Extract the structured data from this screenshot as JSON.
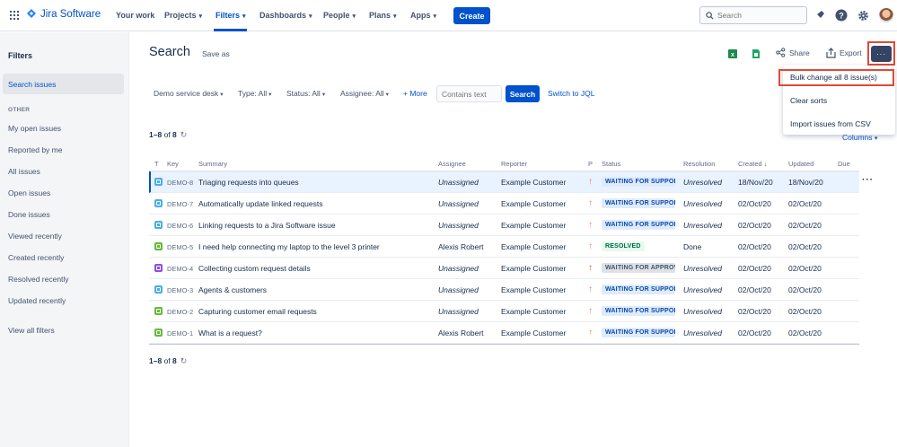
{
  "app": {
    "name": "Jira Software"
  },
  "nav": {
    "items": [
      {
        "label": "Your work",
        "chevron": false
      },
      {
        "label": "Projects",
        "chevron": true
      },
      {
        "label": "Filters",
        "chevron": true,
        "active": true
      },
      {
        "label": "Dashboards",
        "chevron": true
      },
      {
        "label": "People",
        "chevron": true
      },
      {
        "label": "Plans",
        "chevron": true
      },
      {
        "label": "Apps",
        "chevron": true
      }
    ],
    "create_label": "Create",
    "search_placeholder": "Search"
  },
  "sidebar": {
    "title": "Filters",
    "active_item": "Search issues",
    "section_label": "OTHER",
    "items": [
      "My open issues",
      "Reported by me",
      "All issues",
      "Open issues",
      "Done issues",
      "Viewed recently",
      "Created recently",
      "Resolved recently",
      "Updated recently"
    ],
    "footer_item": "View all filters"
  },
  "header": {
    "title": "Search",
    "save_as": "Save as",
    "share": "Share",
    "export": "Export",
    "more": "···"
  },
  "dropdown": {
    "items": [
      "Bulk change all 8 issue(s)",
      "Clear sorts",
      "Import issues from CSV"
    ]
  },
  "filters": {
    "project": "Demo service desk",
    "type": "Type: All",
    "status": "Status: All",
    "assignee": "Assignee: All",
    "more": "+ More",
    "contains_placeholder": "Contains text",
    "search_btn": "Search",
    "switch_jql": "Switch to JQL"
  },
  "results": {
    "range": "1–8",
    "of_text": "of",
    "total": "8",
    "columns_label": "Columns"
  },
  "table": {
    "headers": {
      "t": "T",
      "key": "Key",
      "summary": "Summary",
      "assignee": "Assignee",
      "reporter": "Reporter",
      "p": "P",
      "status": "Status",
      "resolution": "Resolution",
      "created": "Created ↓",
      "updated": "Updated",
      "due": "Due"
    },
    "rows": [
      {
        "key": "DEMO-8",
        "summary": "Triaging requests into queues",
        "assignee": "Unassigned",
        "reporter": "Example Customer",
        "status": "WAITING FOR SUPPORT",
        "resolution": "Unresolved",
        "created": "18/Nov/20",
        "updated": "18/Nov/20",
        "type_color": "#4bade8",
        "prio_color": "#ff7452",
        "status_kind": "blue",
        "unassigned": true
      },
      {
        "key": "DEMO-7",
        "summary": "Automatically update linked requests",
        "assignee": "Unassigned",
        "reporter": "Example Customer",
        "status": "WAITING FOR SUPPORT",
        "resolution": "Unresolved",
        "created": "02/Oct/20",
        "updated": "02/Oct/20",
        "type_color": "#4bade8",
        "prio_color": "#ff7452",
        "status_kind": "blue",
        "unassigned": true
      },
      {
        "key": "DEMO-6",
        "summary": "Linking requests to a Jira Software issue",
        "assignee": "Unassigned",
        "reporter": "Example Customer",
        "status": "WAITING FOR SUPPORT",
        "resolution": "Unresolved",
        "created": "02/Oct/20",
        "updated": "02/Oct/20",
        "type_color": "#4bade8",
        "prio_color": "#ff7452",
        "status_kind": "blue",
        "unassigned": true
      },
      {
        "key": "DEMO-5",
        "summary": "I need help connecting my laptop to the level 3 printer",
        "assignee": "Alexis Robert",
        "reporter": "Example Customer",
        "status": "RESOLVED",
        "resolution": "Done",
        "created": "02/Oct/20",
        "updated": "02/Oct/20",
        "type_color": "#63ba3c",
        "prio_color": "#ff7452",
        "status_kind": "green",
        "unassigned": false
      },
      {
        "key": "DEMO-4",
        "summary": "Collecting custom request details",
        "assignee": "Unassigned",
        "reporter": "Example Customer",
        "status": "WAITING FOR APPROVAL",
        "resolution": "Unresolved",
        "created": "02/Oct/20",
        "updated": "02/Oct/20",
        "type_color": "#904ee2",
        "prio_color": "#e5493a",
        "status_kind": "gray",
        "unassigned": true
      },
      {
        "key": "DEMO-3",
        "summary": "Agents & customers",
        "assignee": "Unassigned",
        "reporter": "Example Customer",
        "status": "WAITING FOR SUPPORT",
        "resolution": "Unresolved",
        "created": "02/Oct/20",
        "updated": "02/Oct/20",
        "type_color": "#4bade8",
        "prio_color": "#ff7452",
        "status_kind": "blue",
        "unassigned": true
      },
      {
        "key": "DEMO-2",
        "summary": "Capturing customer email requests",
        "assignee": "Unassigned",
        "reporter": "Example Customer",
        "status": "WAITING FOR SUPPORT",
        "resolution": "Unresolved",
        "created": "02/Oct/20",
        "updated": "02/Oct/20",
        "type_color": "#63ba3c",
        "prio_color": "#ff7452",
        "status_kind": "blue",
        "unassigned": true
      },
      {
        "key": "DEMO-1",
        "summary": "What is a request?",
        "assignee": "Alexis Robert",
        "reporter": "Example Customer",
        "status": "WAITING FOR SUPPORT",
        "resolution": "Unresolved",
        "created": "02/Oct/20",
        "updated": "02/Oct/20",
        "type_color": "#63ba3c",
        "prio_color": "#ff7452",
        "status_kind": "blue",
        "unassigned": false
      }
    ]
  },
  "colors": {
    "brand": "#0052cc",
    "highlight": "#e34935",
    "lozenge_blue_bg": "#deebff",
    "lozenge_blue_fg": "#0747a6",
    "lozenge_green_bg": "#e3fcef",
    "lozenge_green_fg": "#006644",
    "lozenge_gray_bg": "#dfe1e6",
    "lozenge_gray_fg": "#42526e"
  }
}
